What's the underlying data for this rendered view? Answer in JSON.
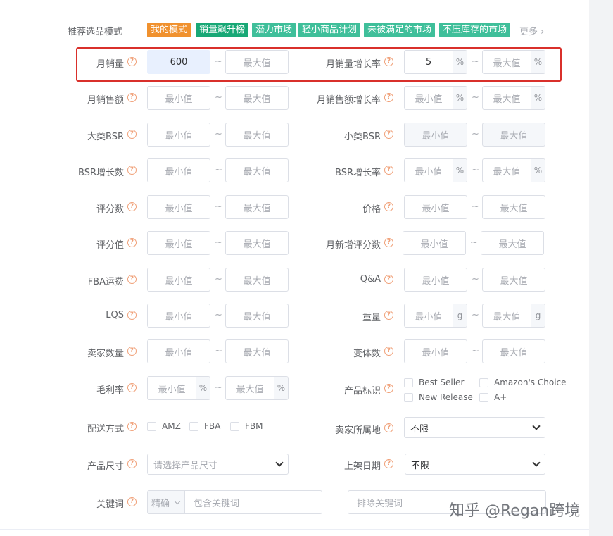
{
  "mode_bar": {
    "label": "推荐选品模式",
    "tags": [
      {
        "label": "我的模式",
        "color": "#f0912e"
      },
      {
        "label": "销量飙升榜",
        "color": "#18a876"
      },
      {
        "label": "潜力市场",
        "color": "#3fbf9a"
      },
      {
        "label": "轻小商品计划",
        "color": "#3fbf9a"
      },
      {
        "label": "未被满足的市场",
        "color": "#3fbf9a"
      },
      {
        "label": "不压库存的市场",
        "color": "#3fbf9a"
      }
    ],
    "more": "更多"
  },
  "common": {
    "min": "最小值",
    "max": "最大值",
    "tilde": "~",
    "pct": "%",
    "g": "g",
    "help": "?"
  },
  "left_fields": [
    {
      "label": "月销量",
      "min_value": "600"
    },
    {
      "label": "月销售额"
    },
    {
      "label": "大类BSR"
    },
    {
      "label": "BSR增长数"
    },
    {
      "label": "评分数"
    },
    {
      "label": "评分值"
    },
    {
      "label": "FBA运费"
    },
    {
      "label": "LQS"
    },
    {
      "label": "卖家数量"
    },
    {
      "label": "毛利率"
    },
    {
      "label": "配送方式"
    },
    {
      "label": "产品尺寸"
    },
    {
      "label": "关键词"
    }
  ],
  "right_fields": [
    {
      "label": "月销量增长率",
      "min_value": "5"
    },
    {
      "label": "月销售额增长率"
    },
    {
      "label": "小类BSR"
    },
    {
      "label": "BSR增长率"
    },
    {
      "label": "价格"
    },
    {
      "label": "月新增评分数"
    },
    {
      "label": "Q&A"
    },
    {
      "label": "重量"
    },
    {
      "label": "变体数"
    },
    {
      "label": "产品标识"
    },
    {
      "label": "卖家所属地"
    },
    {
      "label": "上架日期"
    }
  ],
  "delivery_options": [
    "AMZ",
    "FBA",
    "FBM"
  ],
  "product_flags": [
    "Best Seller",
    "Amazon's Choice",
    "New Release",
    "A+"
  ],
  "size_select": {
    "placeholder": "请选择产品尺寸"
  },
  "seller_location_select": {
    "value": "不限"
  },
  "launch_date_select": {
    "value": "不限"
  },
  "keyword": {
    "mode": "精确",
    "include_placeholder": "包含关键词",
    "exclude_placeholder": "排除关键词"
  },
  "watermark": "知乎 @Regan跨境",
  "colors": {
    "highlight": "#d9302b",
    "help_icon": "#f0a078",
    "active_input": "#e8f0fe"
  }
}
